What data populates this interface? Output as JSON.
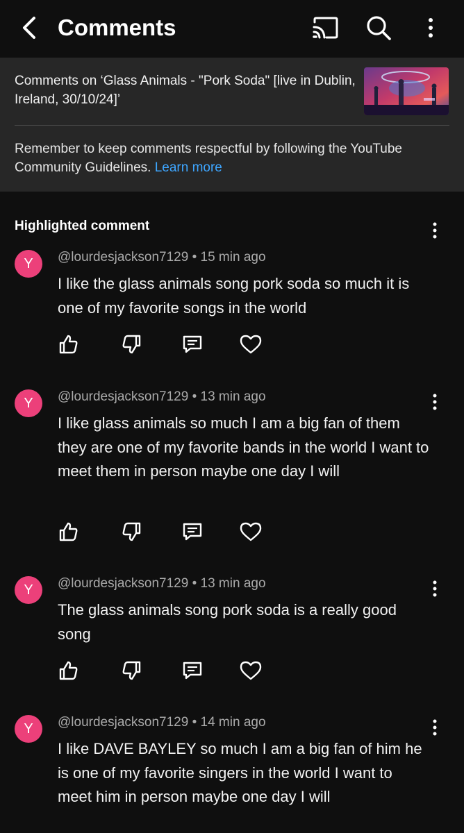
{
  "header": {
    "title": "Comments",
    "icons": {
      "back": "chevron-left-icon",
      "cast": "cast-icon",
      "search": "search-icon",
      "menu": "more-vert-icon"
    }
  },
  "info": {
    "video_title": "Comments on ‘Glass Animals - \"Pork Soda\" [live in Dublin, Ireland, 30/10/24]’",
    "guidelines_text": "Remember to keep comments respectful by following the YouTube Community Guidelines.",
    "learn_more": "Learn more"
  },
  "section": {
    "label": "Highlighted comment"
  },
  "comments": [
    {
      "avatar": "Y",
      "author": "@lourdesjackson7129",
      "time": "15 min ago",
      "text": "I like the glass animals song pork soda so much it is one of my favorite songs in the world"
    },
    {
      "avatar": "Y",
      "author": "@lourdesjackson7129",
      "time": "13 min ago",
      "text": "I like glass animals so much I am a big fan of them they are one of my favorite bands in the world I want to meet them in person maybe one day I will"
    },
    {
      "avatar": "Y",
      "author": "@lourdesjackson7129",
      "time": "13 min ago",
      "text": "The glass animals song pork soda is a really good song"
    },
    {
      "avatar": "Y",
      "author": "@lourdesjackson7129",
      "time": "14 min ago",
      "text": "I like DAVE BAYLEY so much I am a big fan of him he is one of my favorite singers in the world I want to meet him in person maybe one day I will"
    }
  ],
  "colors": {
    "background": "#0f0f0f",
    "panel": "#272727",
    "avatar": "#ec407a",
    "link": "#3ea6ff",
    "secondary_text": "#aaaaaa"
  }
}
